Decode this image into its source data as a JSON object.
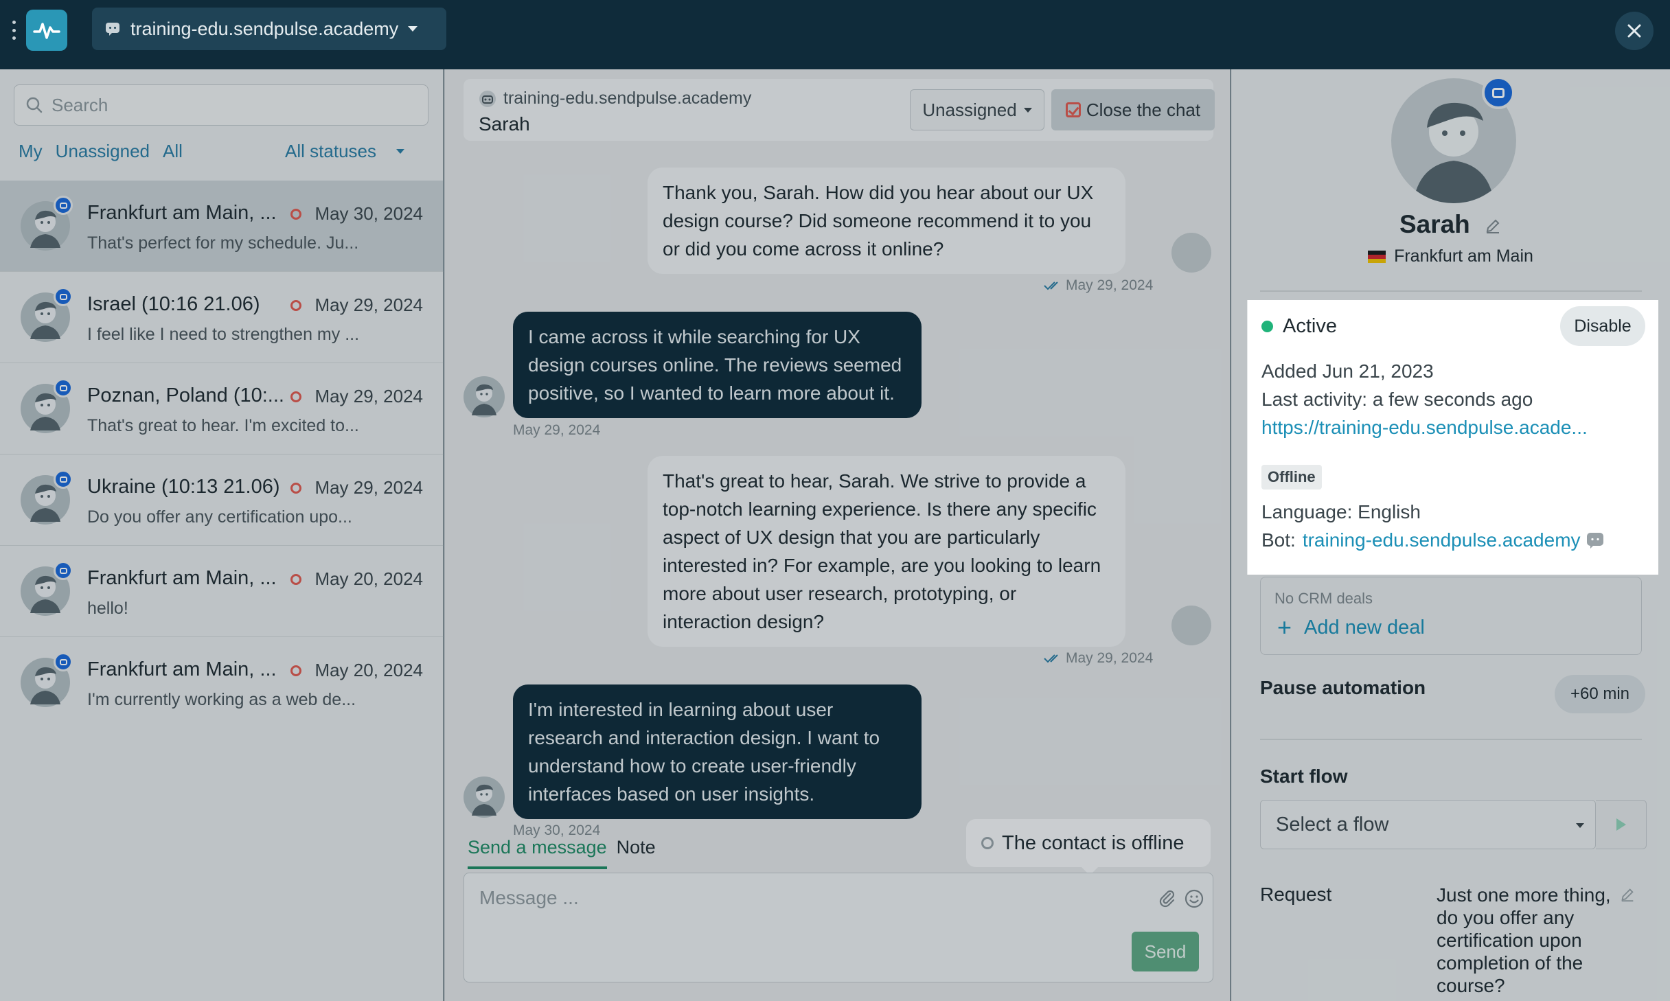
{
  "topbar": {
    "bot_name": "training-edu.sendpulse.academy"
  },
  "sidebar": {
    "search_placeholder": "Search",
    "filters": [
      "My",
      "Unassigned",
      "All"
    ],
    "status_filter": "All statuses",
    "conversations": [
      {
        "name": "Frankfurt am Main, ...",
        "date": "May 30, 2024",
        "preview": "That's perfect for my schedule. Ju..."
      },
      {
        "name": "Israel (10:16 21.06)",
        "date": "May 29, 2024",
        "preview": "I feel like I need to strengthen my ..."
      },
      {
        "name": "Poznan, Poland (10:...",
        "date": "May 29, 2024",
        "preview": "That's great to hear. I'm excited to..."
      },
      {
        "name": "Ukraine (10:13 21.06)",
        "date": "May 29, 2024",
        "preview": "Do you offer any certification upo..."
      },
      {
        "name": "Frankfurt am Main, ...",
        "date": "May 20, 2024",
        "preview": "hello!"
      },
      {
        "name": "Frankfurt am Main, ...",
        "date": "May 20, 2024",
        "preview": "I'm currently working as a web de..."
      }
    ]
  },
  "chat": {
    "bot_name": "training-edu.sendpulse.academy",
    "contact_name": "Sarah",
    "assign_label": "Unassigned",
    "close_label": "Close the chat",
    "messages": [
      {
        "dir": "out",
        "text": "Thank you, Sarah. How did you hear about our UX design course? Did someone recommend it to you or did you come across it online?",
        "date": "May 29, 2024"
      },
      {
        "dir": "in",
        "text": "I came across it while searching for UX design courses online. The reviews seemed positive, so I wanted to learn more about it.",
        "date": "May 29, 2024"
      },
      {
        "dir": "out",
        "text": "That's great to hear, Sarah. We strive to provide a top-notch learning experience. Is there any specific aspect of UX design that you are particularly interested in? For example, are you looking to learn more about user research, prototyping, or interaction design?",
        "date": "May 29, 2024"
      },
      {
        "dir": "in",
        "text": "I'm interested in learning about user research and interaction design. I want to understand how to create user-friendly interfaces based on user insights.",
        "date": "May 30, 2024"
      }
    ],
    "tab_send": "Send a message",
    "tab_note": "Note",
    "offline_notice": "The contact is offline",
    "composer_placeholder": "Message ...",
    "send_label": "Send"
  },
  "contact": {
    "name": "Sarah",
    "location": "Frankfurt am Main",
    "status": "Active",
    "disable_label": "Disable",
    "added": "Added Jun 21, 2023",
    "last_activity": "Last activity: a few seconds ago",
    "url": "https://training-edu.sendpulse.acade...",
    "presence": "Offline",
    "language": "Language: English",
    "bot_prefix": "Bot:",
    "bot_name": "training-edu.sendpulse.academy",
    "crm_empty": "No CRM deals",
    "add_deal": "Add new deal",
    "pause_label": "Pause automation",
    "pause_value": "+60 min",
    "start_flow_label": "Start flow",
    "flow_placeholder": "Select a flow",
    "request_label": "Request",
    "request_value": "Just one more thing, do you offer any certification upon completion of the course?"
  },
  "colors": {
    "topbar": "#0f2b3a",
    "accent_link": "#1b8fb6",
    "active_green": "#20b37a",
    "offline_red": "#e0594f",
    "badge_blue": "#1a68d8"
  }
}
